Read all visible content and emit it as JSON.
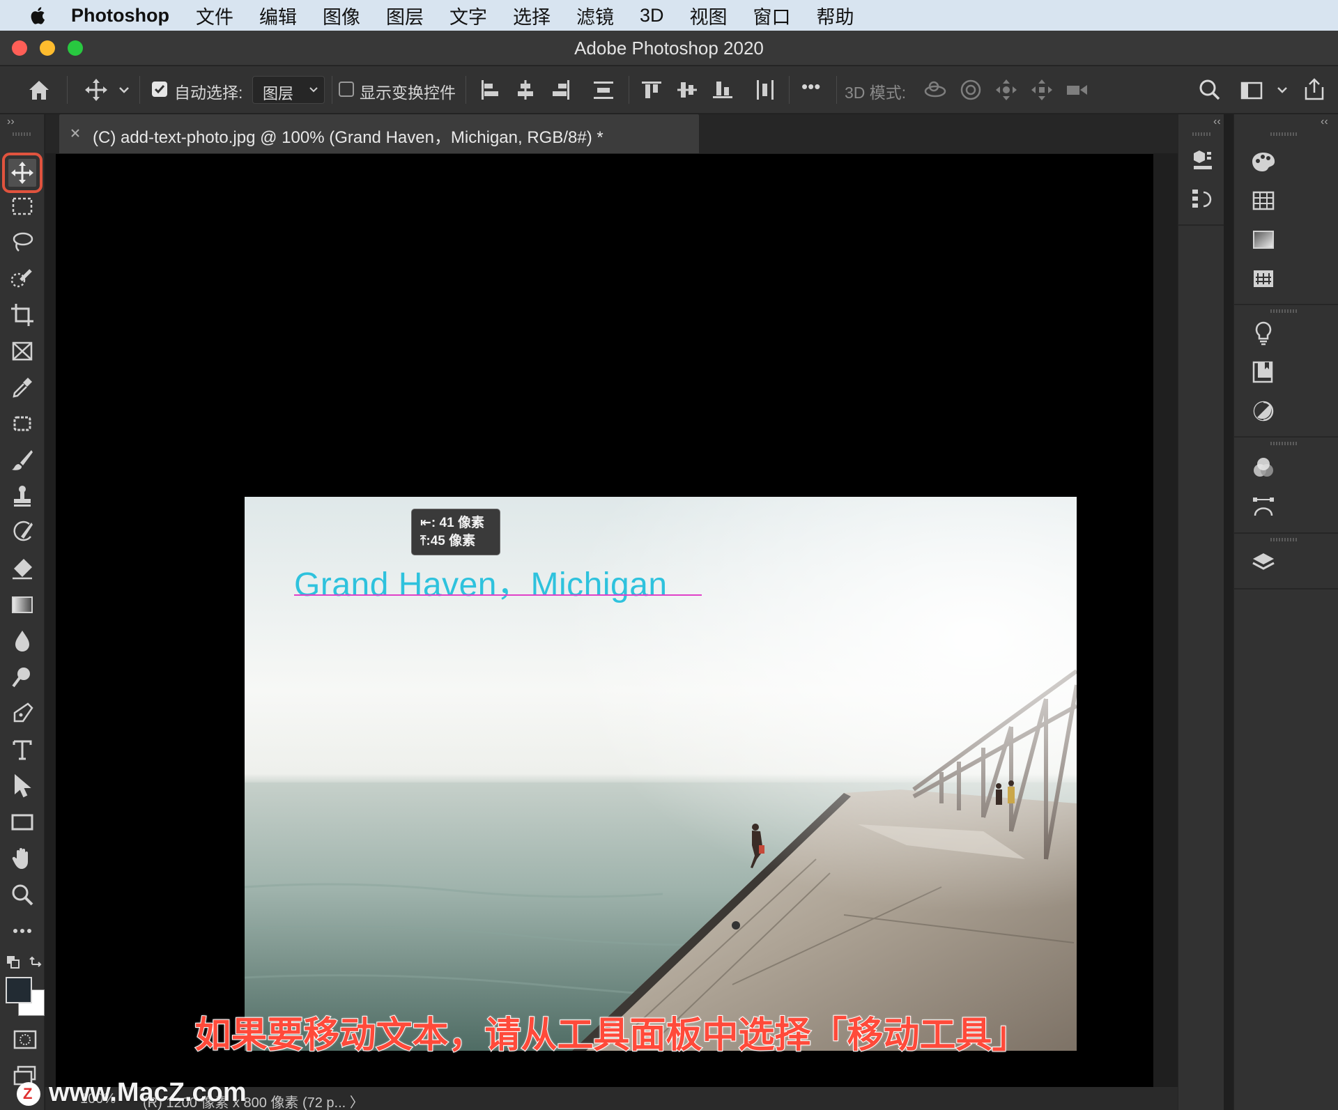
{
  "menubar": {
    "app_name": "Photoshop",
    "items": [
      "文件",
      "编辑",
      "图像",
      "图层",
      "文字",
      "选择",
      "滤镜",
      "3D",
      "视图",
      "窗口",
      "帮助"
    ]
  },
  "window": {
    "title": "Adobe Photoshop 2020"
  },
  "options_bar": {
    "auto_select_label": "自动选择:",
    "auto_select_checked": true,
    "auto_select_target": "图层",
    "show_transform_label": "显示变换控件",
    "show_transform_checked": false,
    "more_label": "•••",
    "mode_3d_label": "3D 模式:"
  },
  "document": {
    "tab_title": "(C) add-text-photo.jpg @ 100% (Grand Haven，Michigan, RGB/8#) *",
    "overlay_text": "Grand Haven，Michigan",
    "tooltip_line1": "⇤: 41 像素",
    "tooltip_line2": "⤒:45 像素"
  },
  "tools": [
    "move-tool",
    "marquee-tool",
    "lasso-tool",
    "quick-selection-tool",
    "crop-tool",
    "frame-tool",
    "eyedropper-tool",
    "patch-tool",
    "brush-tool",
    "stamp-tool",
    "history-brush-tool",
    "eraser-tool",
    "gradient-tool",
    "blur-tool",
    "dodge-tool",
    "pen-tool",
    "type-tool",
    "path-selection-tool",
    "rectangle-tool",
    "hand-tool",
    "zoom-tool",
    "edit-toolbar"
  ],
  "selected_tool": "move-tool",
  "caption": "如果要移动文本，请从工具面板中选择「移动工具」",
  "status_bar": {
    "zoom": "100%",
    "doc_info": "(R) 1200 像素 x 800 像素 (72 p...  〉"
  },
  "watermark": "www.MacZ.com",
  "colors": {
    "accent_selection": "#e0533e",
    "overlay_text": "#2ec2dd",
    "baseline": "#e040c8",
    "caption": "#ff4a3a"
  }
}
